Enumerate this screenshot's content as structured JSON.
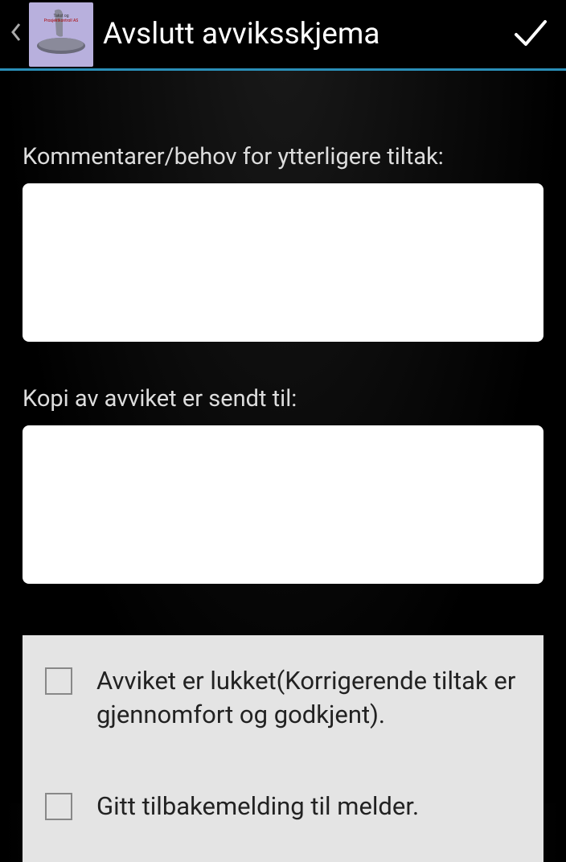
{
  "header": {
    "title": "Avslutt avviksskjema"
  },
  "form": {
    "comments": {
      "label": "Kommentarer/behov for ytterligere tiltak:",
      "value": ""
    },
    "copy_to": {
      "label": "Kopi av avviket er sendt til:",
      "value": ""
    }
  },
  "checkboxes": {
    "closed": {
      "label": "Avviket er lukket(Korrigerende tiltak er gjennomfort og godkjent).",
      "checked": false
    },
    "feedback": {
      "label": "Gitt tilbakemelding til melder.",
      "checked": false
    }
  }
}
